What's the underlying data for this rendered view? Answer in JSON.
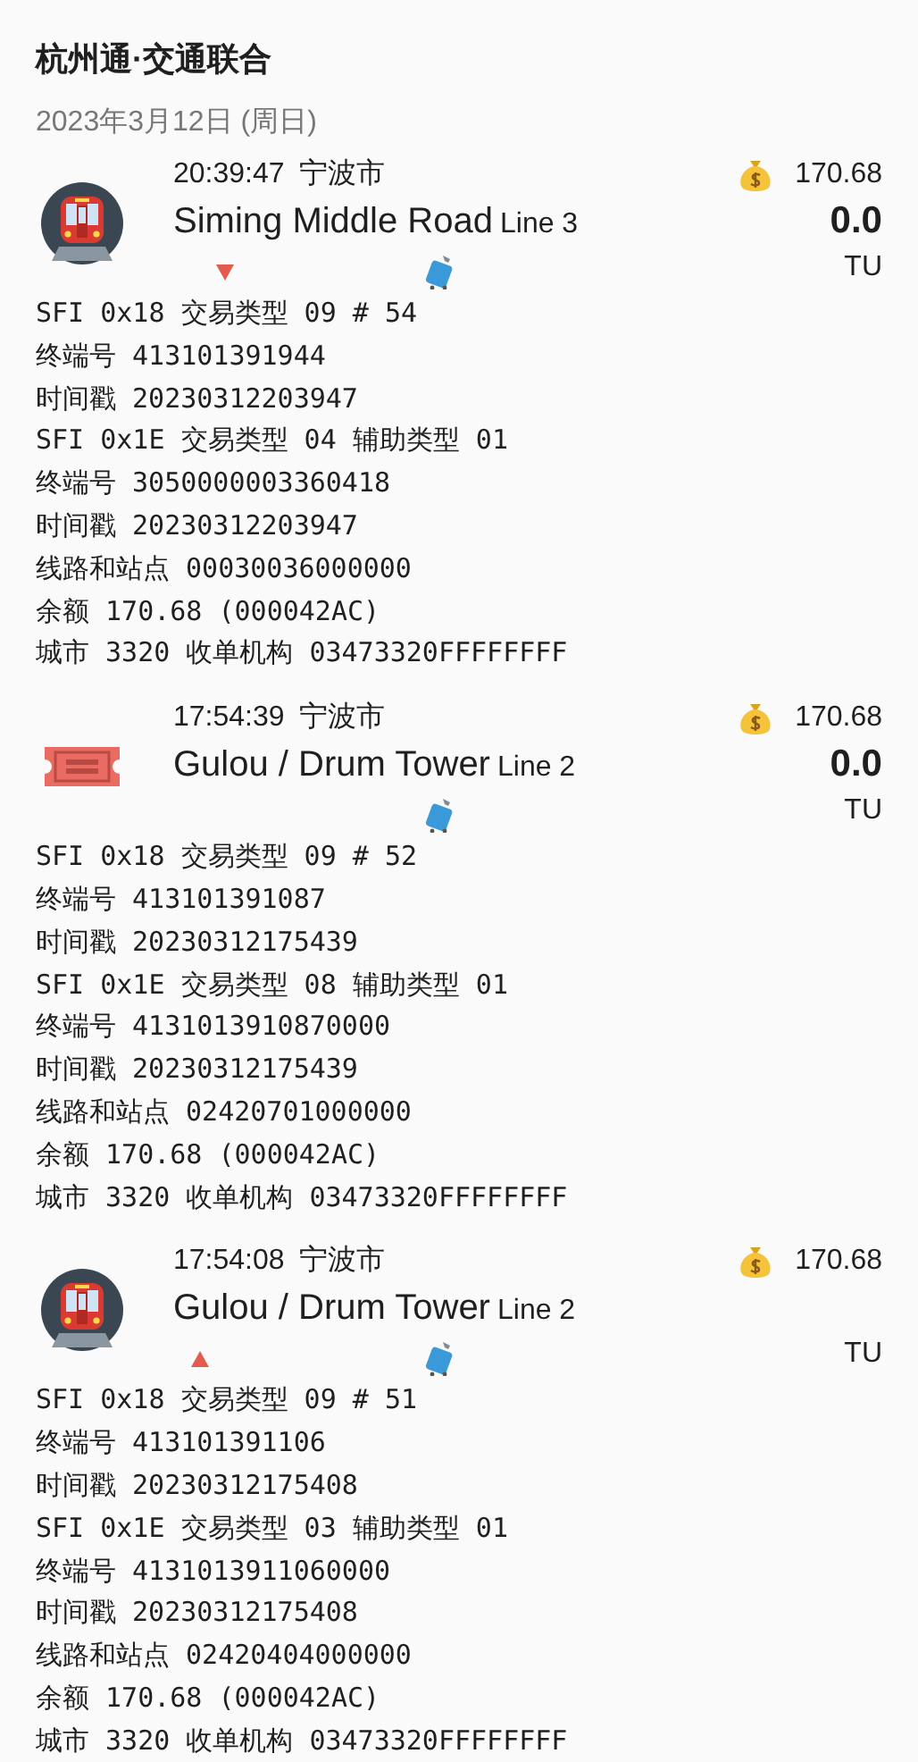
{
  "title": "杭州通·交通联合",
  "date": "2023年3月12日 (周日)",
  "trips": [
    {
      "kind": "metro",
      "time": "20:39:47",
      "city": "宁波市",
      "balance": "170.68",
      "station": "Siming Middle Road",
      "line": "Line 3",
      "fare": "0.0",
      "unit": "TU",
      "arrow_down": true,
      "arrow_up": false,
      "luggage": true,
      "details": [
        "SFI 0x18 交易类型 09 # 54",
        "终端号 413101391944",
        "时间戳 20230312203947",
        "SFI 0x1E 交易类型 04 辅助类型 01",
        "终端号 3050000003360418",
        "时间戳 20230312203947",
        "线路和站点 00030036000000",
        "余额 170.68 (000042AC)",
        "城市 3320 收单机构 03473320FFFFFFFF"
      ]
    },
    {
      "kind": "ticket",
      "time": "17:54:39",
      "city": "宁波市",
      "balance": "170.68",
      "station": "Gulou / Drum Tower",
      "line": "Line 2",
      "fare": "0.0",
      "unit": "TU",
      "arrow_down": false,
      "arrow_up": false,
      "luggage": true,
      "details": [
        "SFI 0x18 交易类型 09 # 52",
        "终端号 413101391087",
        "时间戳 20230312175439",
        "SFI 0x1E 交易类型 08 辅助类型 01",
        "终端号 4131013910870000",
        "时间戳 20230312175439",
        "线路和站点 02420701000000",
        "余额 170.68 (000042AC)",
        "城市 3320 收单机构 03473320FFFFFFFF"
      ]
    },
    {
      "kind": "metro",
      "time": "17:54:08",
      "city": "宁波市",
      "balance": "170.68",
      "station": "Gulou / Drum Tower",
      "line": "Line 2",
      "unit": "TU",
      "arrow_down": false,
      "arrow_up": true,
      "luggage": true,
      "details": [
        "SFI 0x18 交易类型 09 # 51",
        "终端号 413101391106",
        "时间戳 20230312175408",
        "SFI 0x1E 交易类型 03 辅助类型 01",
        "终端号 4131013911060000",
        "时间戳 20230312175408",
        "线路和站点 02420404000000",
        "余额 170.68 (000042AC)",
        "城市 3320 收单机构 03473320FFFFFFFF"
      ]
    }
  ]
}
